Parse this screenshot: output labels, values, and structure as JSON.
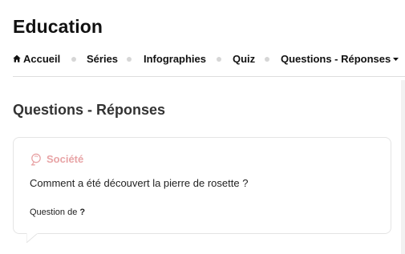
{
  "site": {
    "title": "Education"
  },
  "nav": {
    "items": [
      {
        "label": "Accueil",
        "icon": "home-icon"
      },
      {
        "label": "Séries"
      },
      {
        "label": "Infographies"
      },
      {
        "label": "Quiz"
      },
      {
        "label": "Questions - Réponses",
        "icon": "caret-down-icon"
      }
    ]
  },
  "section": {
    "title": "Questions - Réponses"
  },
  "card": {
    "category": "Société",
    "category_icon": "lightbulb-icon",
    "question": "Comment a été découvert la pierre de rosette ?",
    "author_prefix": "Question de",
    "author_name": "?"
  },
  "colors": {
    "accent": "#e8a4a6",
    "text": "#111111",
    "divider": "#dddddd",
    "card_border": "#e4e4e4"
  }
}
